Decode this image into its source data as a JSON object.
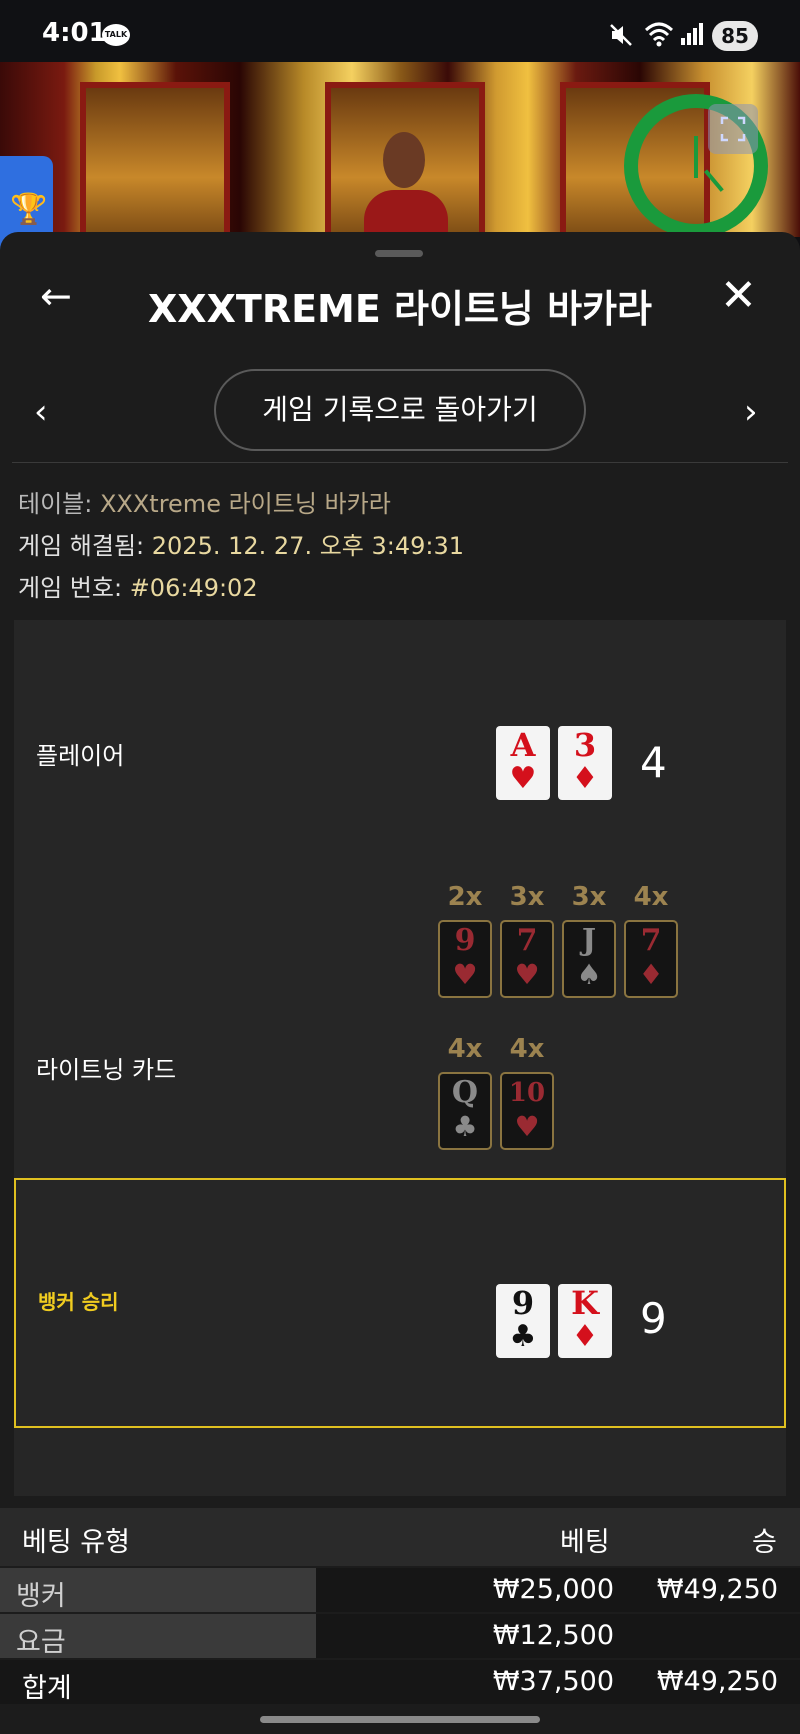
{
  "status_bar": {
    "time": "4:01",
    "talk_badge": "TALK",
    "battery": "85",
    "icons": [
      "mute-icon",
      "wifi-icon",
      "signal-icon"
    ]
  },
  "video": {
    "timer_color": "#1a9a3c",
    "icons": [
      "fullscreen-icon",
      "trophy-icon"
    ]
  },
  "header": {
    "title": "XXXTREME 라이트닝 바카라",
    "back_icon": "arrow-left-icon",
    "close_icon": "close-icon"
  },
  "nav": {
    "prev": "‹",
    "next": "›",
    "history_button": "게임 기록으로 돌아가기"
  },
  "info": {
    "table_label": "테이블:",
    "table_value": "XXXtreme 라이트닝 바카라",
    "resolved_label": "게임 해결됨:",
    "resolved_value": "2025. 12. 27. 오후 3:49:31",
    "number_label": "게임 번호:",
    "number_value": "#06:49:02"
  },
  "result": {
    "player": {
      "label": "플레이어",
      "score": "4",
      "cards": [
        {
          "rank": "A",
          "suit": "♥",
          "color": "red"
        },
        {
          "rank": "3",
          "suit": "♦",
          "color": "red"
        }
      ]
    },
    "lightning": {
      "label": "라이트닝 카드",
      "cards": [
        {
          "mult": "2x",
          "rank": "9",
          "suit": "♥",
          "color": "red"
        },
        {
          "mult": "3x",
          "rank": "7",
          "suit": "♥",
          "color": "red"
        },
        {
          "mult": "3x",
          "rank": "J",
          "suit": "♠",
          "color": "black"
        },
        {
          "mult": "4x",
          "rank": "7",
          "suit": "♦",
          "color": "red"
        },
        {
          "mult": "4x",
          "rank": "Q",
          "suit": "♣",
          "color": "black"
        },
        {
          "mult": "4x",
          "rank": "10",
          "suit": "♥",
          "color": "red"
        }
      ]
    },
    "banker": {
      "label": "뱅커 승리",
      "score": "9",
      "highlight_color": "#e0c020",
      "cards": [
        {
          "rank": "9",
          "suit": "♣",
          "color": "black"
        },
        {
          "rank": "K",
          "suit": "♦",
          "color": "red"
        }
      ]
    }
  },
  "bets": {
    "header": {
      "type": "베팅 유형",
      "bet": "베팅",
      "win": "승"
    },
    "rows": [
      {
        "label": "뱅커",
        "bet": "₩25,000",
        "win": "₩49,250"
      },
      {
        "label": "요금",
        "bet": "₩12,500",
        "win": ""
      },
      {
        "label": "합계",
        "bet": "₩37,500",
        "win": "₩49,250"
      }
    ]
  }
}
